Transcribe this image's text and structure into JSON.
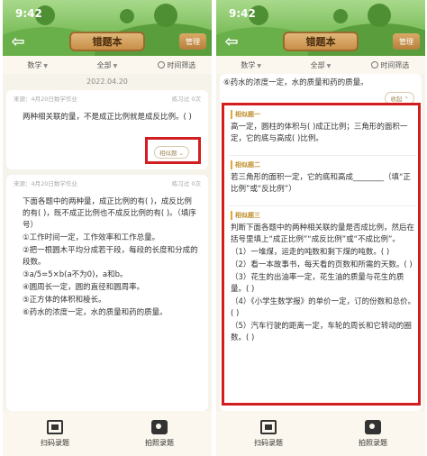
{
  "left": {
    "status_time": "9:42",
    "title": "错题本",
    "manage": "管理",
    "filters": {
      "subject": "数学",
      "grade": "全部",
      "time": "时间筛选"
    },
    "date": "2022.04.20",
    "card1": {
      "source": "来源：4月20日数学作业",
      "practiced": "练习过 0次",
      "text": "两种相关联的量，不是成正比例就是成反比例。( )",
      "similar": "相似题"
    },
    "card2": {
      "source": "来源：4月20日数学作业",
      "practiced": "练习过 0次",
      "lines": [
        "下面各题中的两种量，成正比例的有( )，成反比例的有( )，既不成正比例也不成反比例的有( )。（填序号）",
        "①工作时间一定，工作效率和工作总量。",
        "②把一根圆木平均分成若干段，每段的长度和分成的段数。",
        "③a/5=5×b(a不为0)，a和b。",
        "④圆周长一定，圆的直径和圆周率。",
        "⑤正方体的体积和棱长。",
        "⑥药水的浓度一定，水的质量和药的质量。"
      ]
    },
    "bottom": {
      "scan": "扫码录题",
      "photo": "拍照录题"
    }
  },
  "right": {
    "status_time": "9:42",
    "title": "错题本",
    "manage": "管理",
    "filters": {
      "subject": "数学",
      "grade": "全部",
      "time": "时间筛选"
    },
    "top_text": "⑥药水的浓度一定，水的质量和药的质量。",
    "collapse": "收起",
    "sim1": {
      "title": "相似题一",
      "text": "高一定，圆柱的体积与( )成正比例；三角形的面积一定，它的底与高成( )比例。"
    },
    "sim2": {
      "title": "相似题二",
      "text": "若三角形的面积一定，它的底和高成________（填“正比例”或“反比例”）"
    },
    "sim3": {
      "title": "相似题三",
      "lines": [
        "判断下面各题中的两种相关联的量是否成比例，然后在括号里填上“成正比例”“成反比例”或“不成比例”。",
        "（1）一堆煤，运走的吨数和剩下煤的吨数。( )",
        "（2）看一本故事书，每天看的页数和所需的天数。( )",
        "（3）花生的出油率一定，花生油的质量与花生的质量。( )",
        "（4）《小学生数学报》的单价一定，订的份数和总价。( )",
        "（5）汽车行驶的距离一定，车轮的周长和它转动的圈数。( )"
      ]
    },
    "bottom": {
      "scan": "扫码录题",
      "photo": "拍照录题"
    }
  },
  "colors": {
    "highlight_border": "#d21e1e",
    "header_green": "#7fbf5e",
    "plaque": "#c98f48",
    "similar_title": "#c0902e"
  }
}
